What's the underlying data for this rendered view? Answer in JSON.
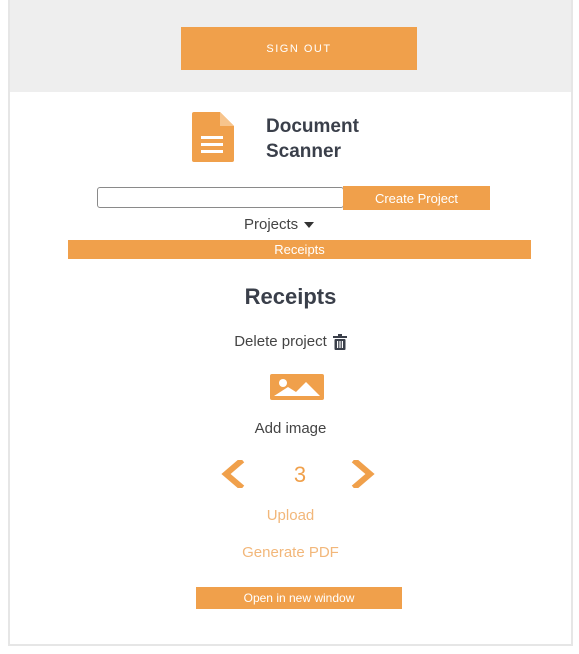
{
  "header": {
    "sign_out_label": "SIGN OUT"
  },
  "app": {
    "title_line1": "Document",
    "title_line2": "Scanner",
    "logo_icon": "document-icon"
  },
  "project_form": {
    "input_value": "",
    "input_placeholder": "",
    "create_label": "Create Project"
  },
  "projects_menu": {
    "toggle_label": "Projects",
    "items": [
      {
        "label": "Receipts"
      }
    ]
  },
  "project": {
    "name": "Receipts",
    "delete_label": "Delete project",
    "delete_icon": "trash-icon",
    "image_icon": "image-icon",
    "add_image_label": "Add image",
    "page_number": "3",
    "upload_label": "Upload",
    "generate_pdf_label": "Generate PDF",
    "open_window_label": "Open in new window"
  },
  "colors": {
    "accent": "#f0a04b",
    "accent_light": "#f2b77a",
    "header_bg": "#eeeeee",
    "text_dark": "#3a3f4a"
  }
}
